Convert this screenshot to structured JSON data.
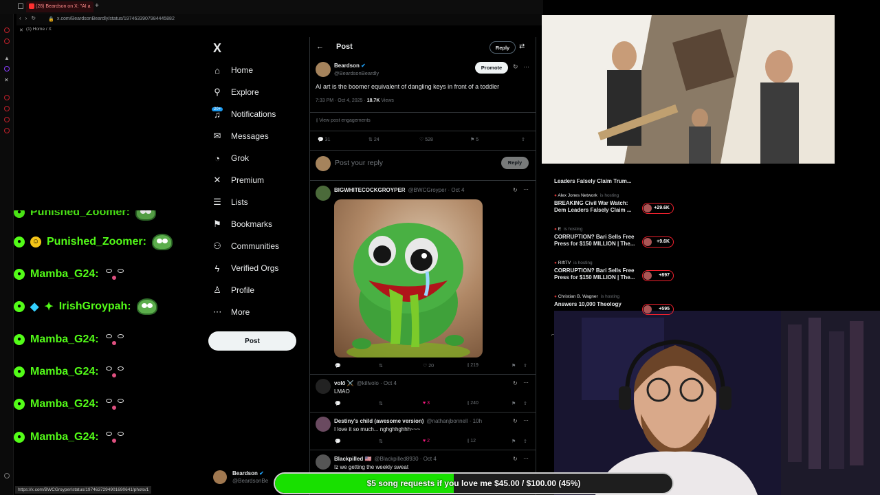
{
  "browser": {
    "tab_title": "(28) Beardson on X: \"AI a",
    "url": "x.com/BeardsonBeardly/status/1974633907984445882",
    "bookmark": "(1) Home / X",
    "status_url": "https://x.com/BWCGroyper/status/1974637294901690641/photo/1"
  },
  "chat": {
    "messages": [
      {
        "user": "Punished_Zoomer:",
        "emote": "pepe"
      },
      {
        "user": "Mamba_G24:",
        "emote": "eyes"
      },
      {
        "user": "IrishGroypah:",
        "emote": "pepe"
      },
      {
        "user": "Mamba_G24:",
        "emote": "eyes"
      },
      {
        "user": "Mamba_G24:",
        "emote": "eyes"
      },
      {
        "user": "Mamba_G24:",
        "emote": "eyes"
      },
      {
        "user": "Mamba_G24:",
        "emote": "eyes"
      }
    ]
  },
  "sidebar": {
    "logo": "X",
    "notif_badge": "20+",
    "items": [
      {
        "label": "Home",
        "icon": "⌂"
      },
      {
        "label": "Explore",
        "icon": "⚲"
      },
      {
        "label": "Notifications",
        "icon": "♫"
      },
      {
        "label": "Messages",
        "icon": "✉"
      },
      {
        "label": "Grok",
        "icon": "◔"
      },
      {
        "label": "Premium",
        "icon": "✕"
      },
      {
        "label": "Lists",
        "icon": "☰"
      },
      {
        "label": "Bookmarks",
        "icon": "⚑"
      },
      {
        "label": "Communities",
        "icon": "⚇"
      },
      {
        "label": "Verified Orgs",
        "icon": "ϟ"
      },
      {
        "label": "Profile",
        "icon": "♙"
      },
      {
        "label": "More",
        "icon": "⋯"
      }
    ],
    "post_label": "Post",
    "account_name": "Beardson",
    "account_handle": "@BeardsonBe"
  },
  "header": {
    "title": "Post",
    "reply_label": "Reply"
  },
  "post": {
    "author": "Beardson",
    "handle": "@BeardsonBeardly",
    "promote": "Promote",
    "text": "AI art is the boomer equivalent of dangling keys in front of a toddler",
    "time": "7:33 PM · Oct 4, 2025 · ",
    "views": "18.7K",
    "views_label": " Views",
    "engagements": "View post engagements",
    "replies": "31",
    "reposts": "24",
    "likes": "528",
    "bookmarks": "5"
  },
  "compose": {
    "placeholder": "Post your reply",
    "button": "Reply"
  },
  "replies": [
    {
      "name": "BIGWHITECOCKGROYPER",
      "handle": "@BWCGroyper · Oct 4",
      "text": "",
      "likes": "20",
      "views": "219"
    },
    {
      "name": "volő ⚔️",
      "handle": "@killvolo · Oct 4",
      "text": "LMAO",
      "likes": "3",
      "views": "240"
    },
    {
      "name": "Destiny's child (awesome version)",
      "handle": "@nathanjbonnell · 10h",
      "text": "I love it so much... nghghhghhh~~~",
      "likes": "2",
      "views": "12"
    },
    {
      "name": "Blackpilled 🇺🇸",
      "handle": "@Blackpilled8930 · Oct 4",
      "text": "Iz we getting the weekly sweat",
      "likes": "",
      "views": ""
    }
  ],
  "live": [
    {
      "host": "",
      "title": "Leaders Falsely Claim Trum...",
      "count": ""
    },
    {
      "host": "Alex Jones Network",
      "title": "BREAKING Civil War Watch: Dem Leaders Falsely Claim ...",
      "count": "+29.6K"
    },
    {
      "host": "E",
      "title": "CORRUPTION? Bari Sells Free Press for $150 MILLION | The...",
      "count": "+9.6K"
    },
    {
      "host": "RIftTV",
      "title": "CORRUPTION? Bari Sells Free Press for $150 MILLION | The...",
      "count": "+897"
    },
    {
      "host": "Christian B. Wagner",
      "title": "Answers 10,000 Theology",
      "count": "+595"
    }
  ],
  "live_hosting": "is hosting",
  "goal": {
    "text": "$5 song requests if you love me $45.00 / $100.00 (45%)",
    "progress": 0.45
  },
  "colors": {
    "accent": "#1d9bf0",
    "kick_green": "#53fc18",
    "like_pink": "#f91880",
    "live_red": "#f4212e"
  }
}
